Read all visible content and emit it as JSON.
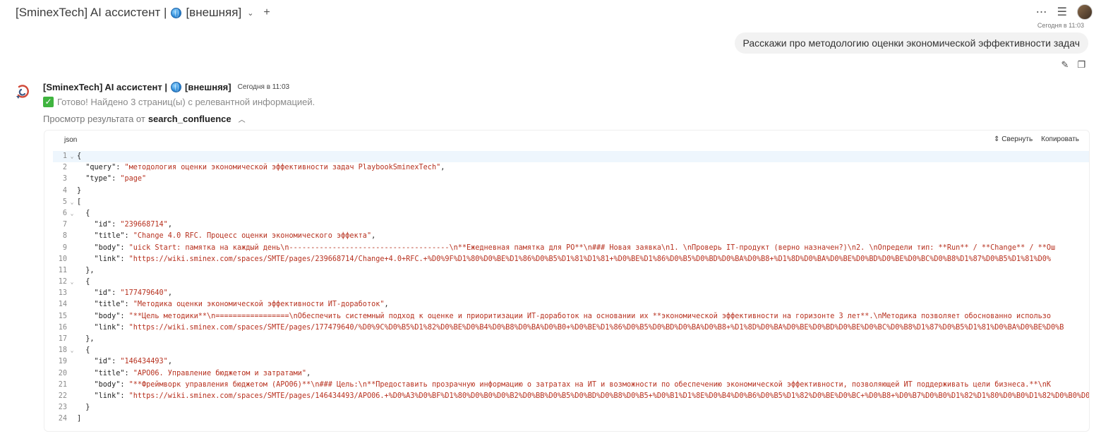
{
  "header": {
    "title_prefix": "[SminexTech] AI ассистент |",
    "title_suffix": "[внешняя]",
    "timestamp": "Сегодня в 11:03"
  },
  "user_message": {
    "text": "Расскажи про методологию оценки экономической эффективности задач"
  },
  "bot": {
    "name_prefix": "[SminexTech] AI ассистент |",
    "name_suffix": "[внешняя]",
    "time": "Сегодня в 11:03",
    "status": "Готово! Найдено 3 страниц(ы) с релевантной информацией.",
    "preview_prefix": "Просмотр результата от",
    "preview_tool": "search_confluence"
  },
  "code": {
    "lang": "json",
    "collapse_label": "Свернуть",
    "copy_label": "Копировать",
    "lines": [
      {
        "n": "1",
        "fold": true,
        "parts": [
          [
            "k",
            "{"
          ]
        ]
      },
      {
        "n": "2",
        "fold": false,
        "parts": [
          [
            "k",
            "  \"query\": "
          ],
          [
            "s",
            "\"методология оценки экономической эффективности задач PlaybookSminexTech\""
          ],
          [
            "k",
            ","
          ]
        ]
      },
      {
        "n": "3",
        "fold": false,
        "parts": [
          [
            "k",
            "  \"type\": "
          ],
          [
            "s",
            "\"page\""
          ]
        ]
      },
      {
        "n": "4",
        "fold": false,
        "parts": [
          [
            "k",
            "}"
          ]
        ]
      },
      {
        "n": "5",
        "fold": true,
        "parts": [
          [
            "k",
            "["
          ]
        ]
      },
      {
        "n": "6",
        "fold": true,
        "parts": [
          [
            "k",
            "  {"
          ]
        ]
      },
      {
        "n": "7",
        "fold": false,
        "parts": [
          [
            "k",
            "    \"id\": "
          ],
          [
            "s",
            "\"239668714\""
          ],
          [
            "k",
            ","
          ]
        ]
      },
      {
        "n": "8",
        "fold": false,
        "parts": [
          [
            "k",
            "    \"title\": "
          ],
          [
            "s",
            "\"Change 4.0 RFC. Процесс оценки экономического эффекта\""
          ],
          [
            "k",
            ","
          ]
        ]
      },
      {
        "n": "9",
        "fold": false,
        "parts": [
          [
            "k",
            "    \"body\": "
          ],
          [
            "s",
            "\"uick Start: памятка на каждый день\\n-------------------------------------\\n**Ежедневная памятка для PO**\\n### Новая заявка\\n1. \\nПроверь IT-продукт (верно назначен?)\\n2. \\nОпредели тип: **Run** / **Change** / **Ош"
          ]
        ]
      },
      {
        "n": "10",
        "fold": false,
        "parts": [
          [
            "k",
            "    \"link\": "
          ],
          [
            "s",
            "\"https://wiki.sminex.com/spaces/SMTE/pages/239668714/Change+4.0+RFC.+%D0%9F%D1%80%D0%BE%D1%86%D0%B5%D1%81%D1%81+%D0%BE%D1%86%D0%B5%D0%BD%D0%BA%D0%B8+%D1%8D%D0%BA%D0%BE%D0%BD%D0%BE%D0%BC%D0%B8%D1%87%D0%B5%D1%81%D0%"
          ]
        ]
      },
      {
        "n": "11",
        "fold": false,
        "parts": [
          [
            "k",
            "  },"
          ]
        ]
      },
      {
        "n": "12",
        "fold": true,
        "parts": [
          [
            "k",
            "  {"
          ]
        ]
      },
      {
        "n": "13",
        "fold": false,
        "parts": [
          [
            "k",
            "    \"id\": "
          ],
          [
            "s",
            "\"177479640\""
          ],
          [
            "k",
            ","
          ]
        ]
      },
      {
        "n": "14",
        "fold": false,
        "parts": [
          [
            "k",
            "    \"title\": "
          ],
          [
            "s",
            "\"Методика оценки экономической эффективности ИТ-доработок\""
          ],
          [
            "k",
            ","
          ]
        ]
      },
      {
        "n": "15",
        "fold": false,
        "parts": [
          [
            "k",
            "    \"body\": "
          ],
          [
            "s",
            "\"**Цель методики**\\n=================\\nОбеспечить системный подход к оценке и приоритизации ИТ-доработок на основании их **экономической эффективности на горизонте 3 лет**.\\nМетодика позволяет обоснованно использо"
          ]
        ]
      },
      {
        "n": "16",
        "fold": false,
        "parts": [
          [
            "k",
            "    \"link\": "
          ],
          [
            "s",
            "\"https://wiki.sminex.com/spaces/SMTE/pages/177479640/%D0%9C%D0%B5%D1%82%D0%BE%D0%B4%D0%B8%D0%BA%D0%B0+%D0%BE%D1%86%D0%B5%D0%BD%D0%BA%D0%B8+%D1%8D%D0%BA%D0%BE%D0%BD%D0%BE%D0%BC%D0%B8%D1%87%D0%B5%D1%81%D0%BA%D0%BE%D0%B"
          ]
        ]
      },
      {
        "n": "17",
        "fold": false,
        "parts": [
          [
            "k",
            "  },"
          ]
        ]
      },
      {
        "n": "18",
        "fold": true,
        "parts": [
          [
            "k",
            "  {"
          ]
        ]
      },
      {
        "n": "19",
        "fold": false,
        "parts": [
          [
            "k",
            "    \"id\": "
          ],
          [
            "s",
            "\"146434493\""
          ],
          [
            "k",
            ","
          ]
        ]
      },
      {
        "n": "20",
        "fold": false,
        "parts": [
          [
            "k",
            "    \"title\": "
          ],
          [
            "s",
            "\"APO06. Управление бюджетом и затратами\""
          ],
          [
            "k",
            ","
          ]
        ]
      },
      {
        "n": "21",
        "fold": false,
        "parts": [
          [
            "k",
            "    \"body\": "
          ],
          [
            "s",
            "\"**Фреймворк управления бюджетом (APO06)**\\n### Цель:\\n**Предоставить прозрачную информацию о затратах на ИТ и возможности по обеспечению экономической эффективности, позволяющей ИТ поддерживать цели бизнеса.**\\nК"
          ]
        ]
      },
      {
        "n": "22",
        "fold": false,
        "parts": [
          [
            "k",
            "    \"link\": "
          ],
          [
            "s",
            "\"https://wiki.sminex.com/spaces/SMTE/pages/146434493/APO06.+%D0%A3%D0%BF%D1%80%D0%B0%D0%B2%D0%BB%D0%B5%D0%BD%D0%B8%D0%B5+%D0%B1%D1%8E%D0%B4%D0%B6%D0%B5%D1%82%D0%BE%D0%BC+%D0%B8+%D0%B7%D0%B0%D1%82%D1%80%D0%B0%D1%82%D0%B0%D0%BC%D0%B8"
          ]
        ]
      },
      {
        "n": "23",
        "fold": false,
        "parts": [
          [
            "k",
            "  }"
          ]
        ]
      },
      {
        "n": "24",
        "fold": false,
        "parts": [
          [
            "k",
            "]"
          ]
        ]
      }
    ]
  }
}
